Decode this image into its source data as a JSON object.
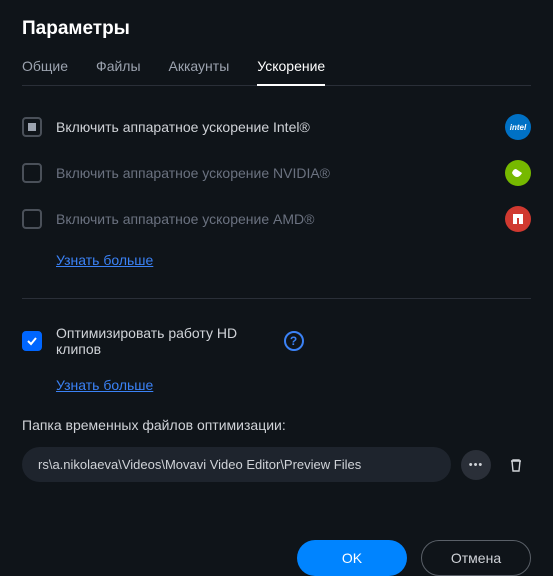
{
  "title": "Параметры",
  "tabs": {
    "general": "Общие",
    "files": "Файлы",
    "accounts": "Аккаунты",
    "acceleration": "Ускорение"
  },
  "accel": {
    "intel": "Включить аппаратное ускорение Intel®",
    "nvidia": "Включить аппаратное ускорение NVIDIA®",
    "amd": "Включить аппаратное ускорение AMD®",
    "learn_more": "Узнать больше"
  },
  "hd": {
    "optimize": "Оптимизировать работу HD клипов",
    "learn_more": "Узнать больше"
  },
  "folder": {
    "label": "Папка временных файлов оптимизации:",
    "path": "rs\\a.nikolaeva\\Videos\\Movavi Video Editor\\Preview Files"
  },
  "buttons": {
    "ok": "OK",
    "cancel": "Отмена"
  },
  "icons": {
    "intel": "intel",
    "help": "?",
    "dots": "•••"
  }
}
